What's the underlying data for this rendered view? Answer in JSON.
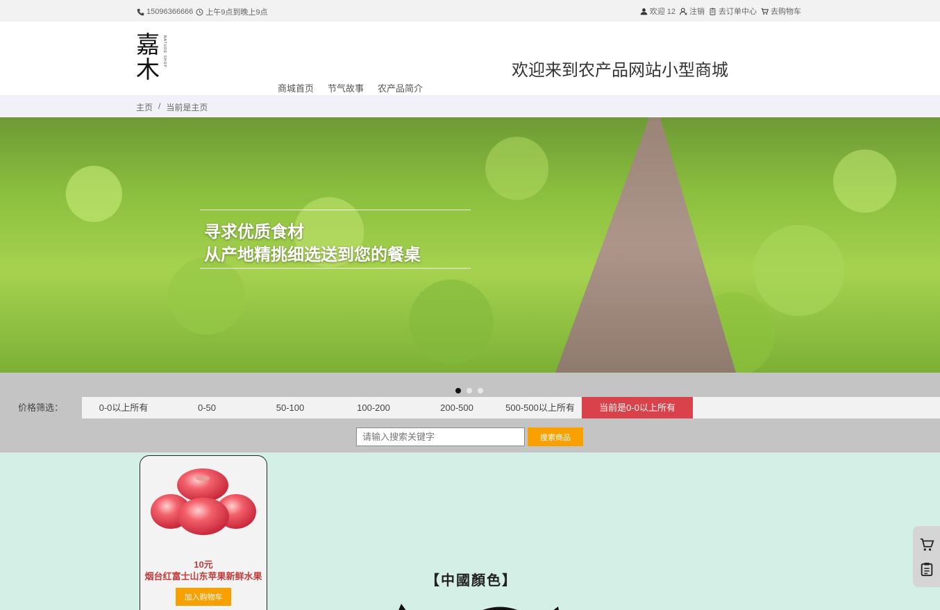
{
  "topbar": {
    "phone": "15096366666",
    "hours": "上午9点到晚上9点",
    "welcome_user": "欢迎 12",
    "logout": "注销",
    "orders": "去订单中心",
    "cart": "去购物车"
  },
  "header": {
    "logo_chars": "嘉木",
    "logo_vertical": "NATURE SHOP",
    "welcome": "欢迎来到农产品网站小型商城",
    "nav": [
      "商城首页",
      "节气故事",
      "农产品简介"
    ]
  },
  "breadcrumb": {
    "home": "主页",
    "separator": "/",
    "current": "当前是主页"
  },
  "banner": {
    "line1": "寻求优质食材",
    "line2": "从产地精挑细选送到您的餐桌",
    "active_dot": 0
  },
  "filter": {
    "label": "价格筛选：",
    "options": [
      "0-0以上所有",
      "0-50",
      "50-100",
      "100-200",
      "200-500",
      "500-500以上所有"
    ],
    "current": "当前是0-0以上所有",
    "current_color": "#d9424a"
  },
  "search": {
    "placeholder": "请输入搜索关键字",
    "button": "搜索商品",
    "button_color": "#f7a000"
  },
  "products": [
    {
      "price": "10元",
      "name": "烟台红富士山东苹果新鲜水果",
      "add_to_cart": "加入购物车"
    }
  ],
  "promo": {
    "title": "【中國顏色】"
  },
  "side_tools": {
    "icons": [
      "cart-icon",
      "clipboard-icon"
    ]
  }
}
